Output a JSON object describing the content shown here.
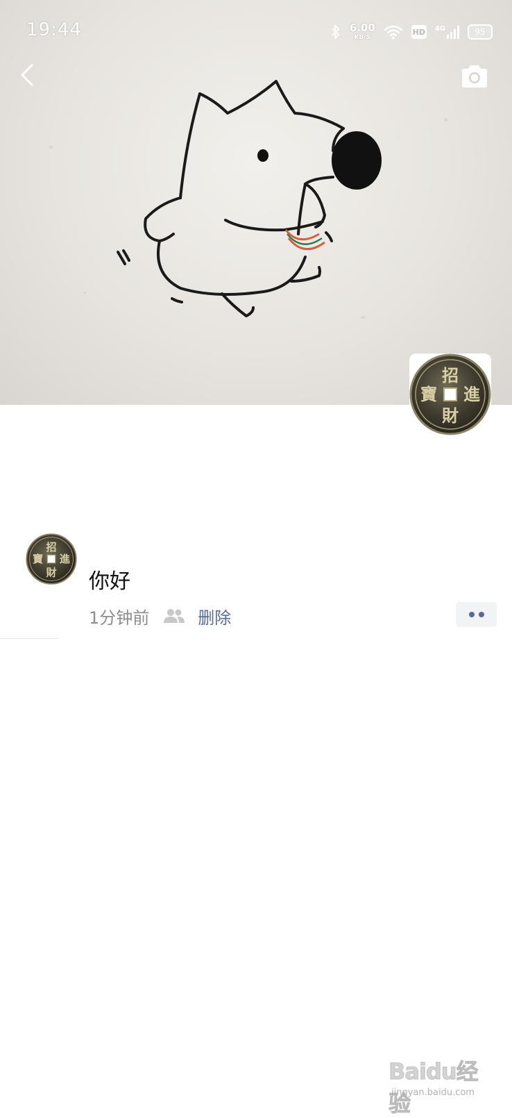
{
  "status_bar": {
    "time": "19:44",
    "net_speed_value": "6.00",
    "net_speed_unit": "KB/S",
    "hd_label": "HD",
    "network_type": "4G",
    "battery_level": "95",
    "icons": [
      "bluetooth-icon",
      "wifi-icon",
      "hd-icon",
      "signal-icon",
      "battery-icon"
    ]
  },
  "header": {
    "back_icon": "chevron-left-icon",
    "camera_icon": "camera-icon"
  },
  "cover": {
    "illustration": "cartoon-dog-running"
  },
  "profile": {
    "avatar": "ancient-coin-avatar",
    "coin_text": "招進財寶"
  },
  "post": {
    "text": "你好",
    "time": "1分钟前",
    "visibility_icon": "friends-visibility-icon",
    "delete_label": "删除",
    "more_icon": "more-dots-icon"
  },
  "watermark": {
    "brand": "Baidu经验",
    "url": "jingyan.baidu.com"
  },
  "colors": {
    "link": "#576b95",
    "meta_gray": "#8d8d8d",
    "more_bg": "#f2f3f5"
  }
}
